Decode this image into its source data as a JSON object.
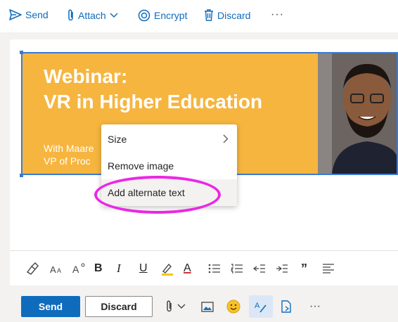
{
  "toolbar": {
    "send_label": "Send",
    "attach_label": "Attach",
    "encrypt_label": "Encrypt",
    "discard_label": "Discard",
    "more_label": "···"
  },
  "banner": {
    "title": "Webinar:\nVR in Higher Education",
    "subtitle": "With Maare\nVP of Proc"
  },
  "context_menu": {
    "items": [
      {
        "label": "Size",
        "submenu": true
      },
      {
        "label": "Remove image",
        "submenu": false
      },
      {
        "label": "Add alternate text",
        "submenu": false,
        "highlighted": true
      }
    ]
  },
  "format_toolbar": {
    "bold": "B",
    "italic": "I",
    "underline": "U",
    "font_color": "A",
    "quote": "”"
  },
  "bottom_bar": {
    "send_label": "Send",
    "discard_label": "Discard",
    "more_label": "···"
  },
  "colors": {
    "accent": "#0f6cbd",
    "banner": "#f6b53f",
    "highlight_oval": "#ea28e4"
  },
  "icons": [
    "send-icon",
    "paperclip-icon",
    "chevron-down-icon",
    "encrypt-icon",
    "trash-icon",
    "format-painter-icon",
    "font-size-icon",
    "text-effects-icon",
    "highlight-icon",
    "bullets-icon",
    "numbering-icon",
    "outdent-icon",
    "indent-icon",
    "align-icon",
    "image-icon",
    "emoji-icon",
    "editor-icon",
    "file-icon"
  ]
}
